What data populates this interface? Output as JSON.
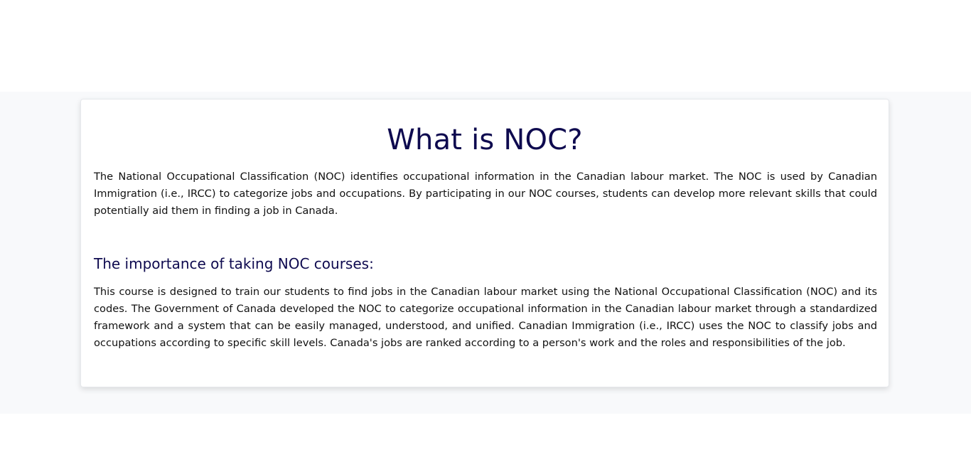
{
  "section": {
    "title": "What is NOC?",
    "intro": "The National Occupational Classification (NOC) identifies occupational information in the Canadian labour market. The NOC is used by Canadian Immigration (i.e., IRCC) to categorize jobs and occupations. By participating in our NOC courses, students can develop more relevant skills that could potentially aid them in finding a job in Canada.",
    "subheading": "The importance of taking NOC courses:",
    "body": "This course is designed to train our students to find jobs in the Canadian labour market using the National Occupational Classification (NOC) and its codes. The Government of Canada developed the NOC to categorize occupational information in the Canadian labour market through a standardized framework and a system that can be easily managed, understood, and unified. Canadian Immigration (i.e., IRCC) uses the NOC to classify jobs and occupations according to specific skill levels. Canada's jobs are ranked according to a person's work and the roles and responsibilities of the job."
  },
  "colors": {
    "heading": "#0e0a4f",
    "text": "#111111",
    "band_background": "#f8f9fb",
    "card_background": "#ffffff"
  }
}
